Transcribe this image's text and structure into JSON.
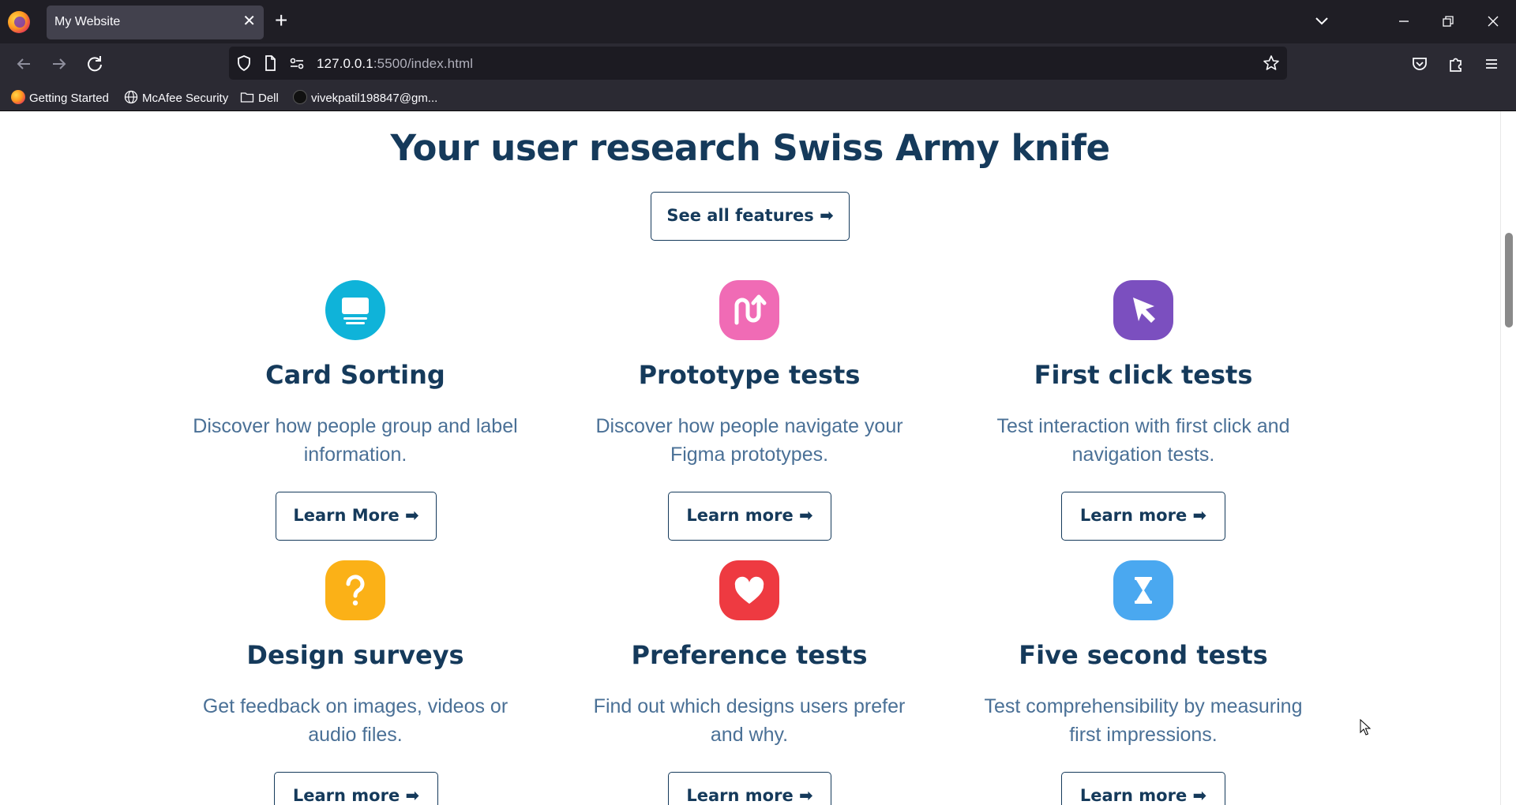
{
  "browser": {
    "tab_title": "My Website",
    "tab_close": "✕",
    "new_tab": "+",
    "url_host": "127.0.0.1",
    "url_rest": ":5500/index.html",
    "bookmarks": [
      {
        "label": "Getting Started",
        "icon": "firefox-icon"
      },
      {
        "label": "McAfee Security",
        "icon": "globe-icon"
      },
      {
        "label": "Dell",
        "icon": "folder-icon"
      },
      {
        "label": "vivekpatil198847@gm...",
        "icon": "site-icon"
      }
    ]
  },
  "page": {
    "headline": "Your user research Swiss Army knife",
    "see_all_label": "See all features ➡",
    "features": [
      {
        "title": "Card Sorting",
        "description": "Discover how people group and label information.",
        "button": "Learn More ➡",
        "icon": "card-sorting-icon",
        "color": "#0fb3d9"
      },
      {
        "title": "Prototype tests",
        "description": "Discover how people navigate your Figma prototypes.",
        "button": "Learn more ➡",
        "icon": "prototype-icon",
        "color": "#f06bb5"
      },
      {
        "title": "First click tests",
        "description": "Test interaction with first click and navigation tests.",
        "button": "Learn more ➡",
        "icon": "cursor-click-icon",
        "color": "#7b4fbf"
      },
      {
        "title": "Design surveys",
        "description": "Get feedback on images, videos or audio files.",
        "button": "Learn more ➡",
        "icon": "question-icon",
        "color": "#fbb117"
      },
      {
        "title": "Preference tests",
        "description": "Find out which designs users prefer and why.",
        "button": "Learn more ➡",
        "icon": "heart-icon",
        "color": "#ee3a41"
      },
      {
        "title": "Five second tests",
        "description": "Test comprehensibility by measuring first impressions.",
        "button": "Learn more ➡",
        "icon": "hourglass-icon",
        "color": "#4aa8f0"
      }
    ]
  },
  "colors": {
    "heading": "#153a5b",
    "body_text": "#4a7096"
  }
}
